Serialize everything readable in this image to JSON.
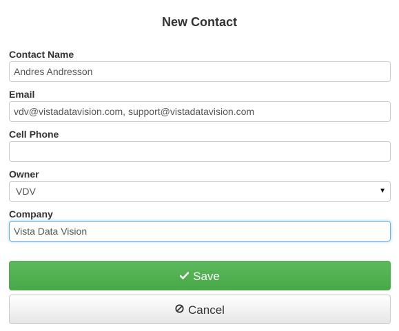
{
  "form": {
    "title": "New Contact",
    "fields": {
      "contact_name": {
        "label": "Contact Name",
        "value": "Andres Andresson"
      },
      "email": {
        "label": "Email",
        "value": "vdv@vistadatavision.com, support@vistadatavision.com"
      },
      "cell_phone": {
        "label": "Cell Phone",
        "value": ""
      },
      "owner": {
        "label": "Owner",
        "value": "VDV"
      },
      "company": {
        "label": "Company",
        "value": "Vista Data Vision"
      }
    },
    "buttons": {
      "save": {
        "label": "Save",
        "icon": "checkmark-icon",
        "color": "#5cb85c"
      },
      "cancel": {
        "label": "Cancel",
        "icon": "ban-icon"
      }
    }
  }
}
